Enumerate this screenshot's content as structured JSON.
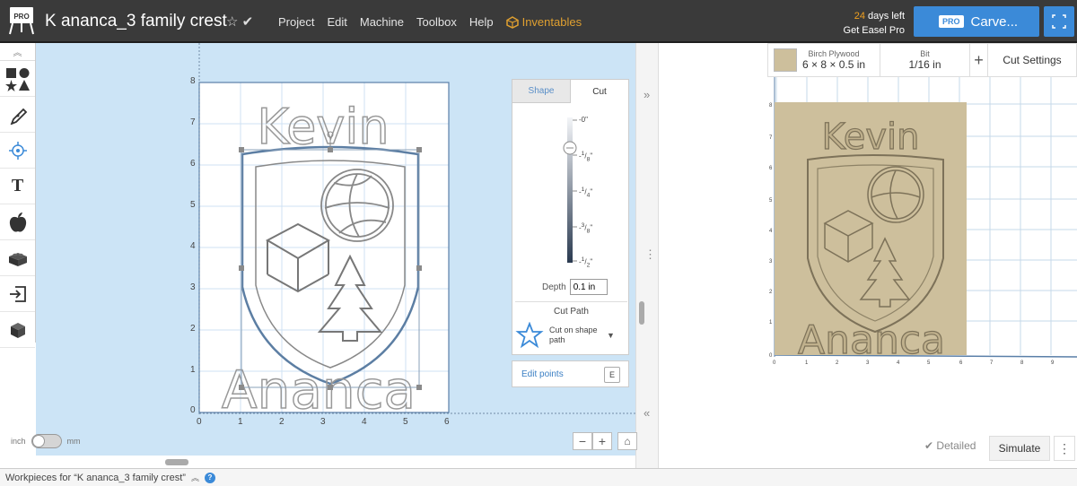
{
  "header": {
    "logo_badge": "PRO",
    "title": "K ananca_3 family crest",
    "star_icon": "☆",
    "check_icon": "✔",
    "menu": [
      "Project",
      "Edit",
      "Machine",
      "Toolbox",
      "Help"
    ],
    "inventables": "Inventables",
    "trial_days": "24",
    "trial_suffix": "days left",
    "trial_cta": "Get Easel Pro",
    "carve_badge": "PRO",
    "carve_label": "Carve..."
  },
  "toolbar": {
    "collapse": "«",
    "tools": [
      "shapes-icon",
      "pen-icon",
      "target-icon",
      "text-icon",
      "apple-icon",
      "lego-icon",
      "import-icon",
      "3d-box-icon"
    ],
    "text_tool_glyph": "T"
  },
  "canvas": {
    "y_ticks": [
      "8",
      "7",
      "6",
      "5",
      "4",
      "3",
      "2",
      "1",
      "0"
    ],
    "x_ticks": [
      "0",
      "1",
      "2",
      "3",
      "4",
      "5",
      "6"
    ],
    "design_text_top": "Kevin",
    "design_text_bottom": "Ananca",
    "collapse_left": "»",
    "collapse_right": "«",
    "resize_grip": "⋮"
  },
  "cut_panel": {
    "tab_shape": "Shape",
    "tab_cut": "Cut",
    "depth_ticks": [
      {
        "whole": "-0",
        "num": "",
        "den": "",
        "unit": "\""
      },
      {
        "whole": "-",
        "num": "1",
        "den": "8",
        "unit": "\""
      },
      {
        "whole": "-",
        "num": "1",
        "den": "4",
        "unit": "\""
      },
      {
        "whole": "-",
        "num": "3",
        "den": "8",
        "unit": "\""
      },
      {
        "whole": "-",
        "num": "1",
        "den": "2",
        "unit": "\""
      }
    ],
    "depth_label": "Depth",
    "depth_value": "0.1 in",
    "cut_path_title": "Cut Path",
    "cut_path_option": "Cut on shape path",
    "edit_points": "Edit points",
    "edit_points_key": "E"
  },
  "units": {
    "left": "inch",
    "right": "mm"
  },
  "zoom": {
    "minus": "−",
    "plus": "+",
    "home": "⌂"
  },
  "bottom": {
    "workpieces": "Workpieces for “K ananca_3 family crest”",
    "chevron": "≈",
    "help": "?"
  },
  "preview": {
    "material_name": "Birch Plywood",
    "material_size": "6 × 8 × 0.5 in",
    "bit_label": "Bit",
    "bit_value": "1/16 in",
    "add": "+",
    "cut_settings": "Cut Settings",
    "y_ticks": [
      "8",
      "7",
      "6",
      "5",
      "4",
      "3",
      "2",
      "1",
      "0"
    ],
    "x_ticks": [
      "0",
      "1",
      "2",
      "3",
      "4",
      "5",
      "6",
      "7",
      "8",
      "9"
    ],
    "carved_text_top": "Kevin",
    "carved_text_bottom": "Ananca",
    "material_color": "#cdbf9c"
  },
  "bottom_right": {
    "detailed_check": "✔",
    "detailed": "Detailed",
    "simulate": "Simulate",
    "more": "⋮"
  },
  "colors": {
    "accent_blue": "#3b8ad8",
    "trial_orange": "#f0a020",
    "canvas_bg": "#cce4f6"
  }
}
